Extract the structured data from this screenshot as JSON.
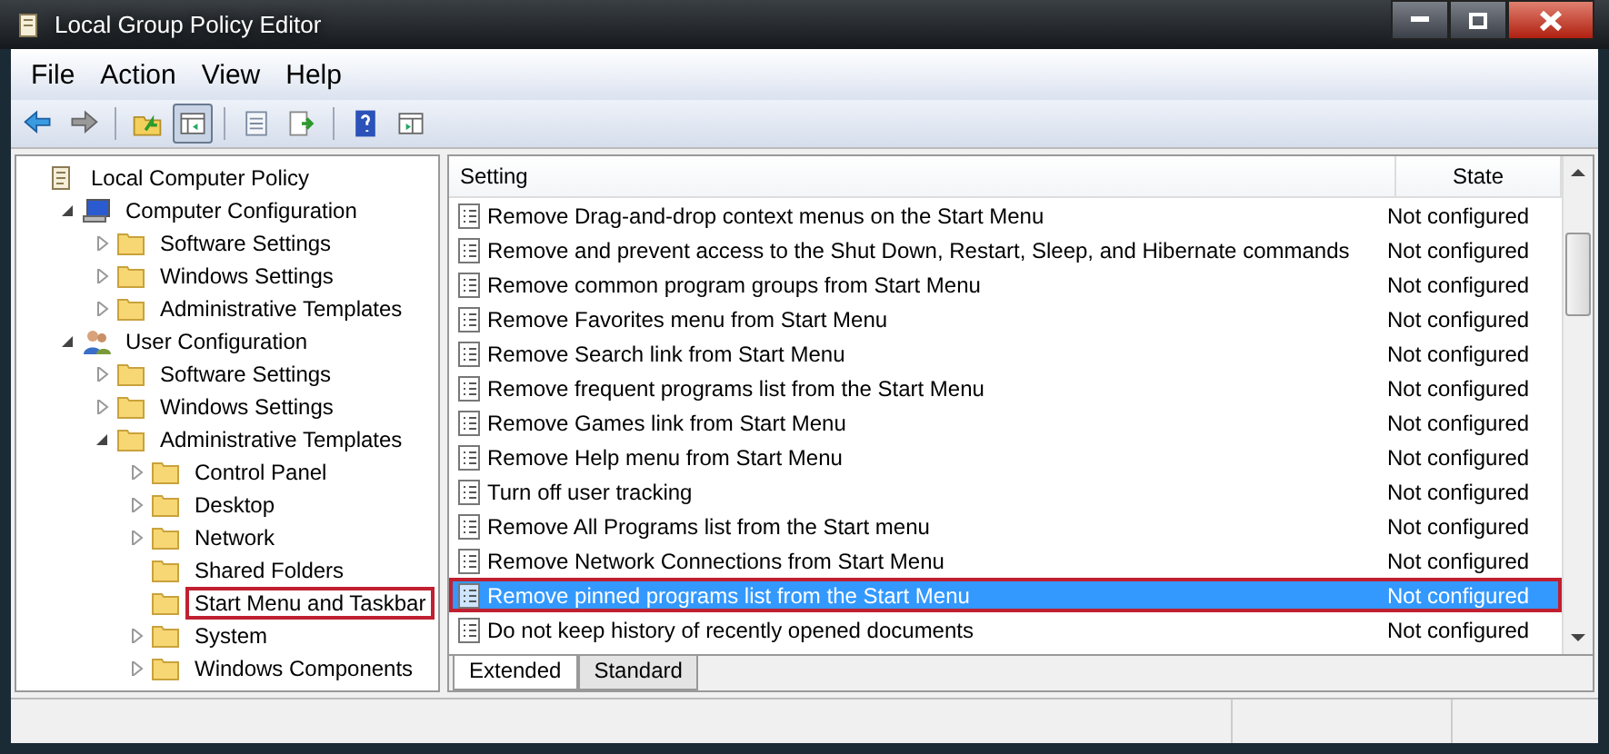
{
  "window": {
    "title": "Local Group Policy Editor"
  },
  "menu": [
    {
      "label": "File"
    },
    {
      "label": "Action"
    },
    {
      "label": "View"
    },
    {
      "label": "Help"
    }
  ],
  "toolbar": [
    {
      "kind": "back",
      "selected": false
    },
    {
      "kind": "forward",
      "selected": false
    },
    {
      "kind": "sep"
    },
    {
      "kind": "up",
      "selected": false
    },
    {
      "kind": "tree",
      "selected": true
    },
    {
      "kind": "sep"
    },
    {
      "kind": "properties",
      "selected": false
    },
    {
      "kind": "export",
      "selected": false
    },
    {
      "kind": "sep"
    },
    {
      "kind": "help",
      "selected": false
    },
    {
      "kind": "view",
      "selected": false
    }
  ],
  "tree": [
    {
      "label": "Local Computer Policy",
      "kind": "policy",
      "highlighted": false,
      "children": [
        {
          "label": "Computer Configuration",
          "kind": "computer",
          "expanded": true,
          "highlighted": false,
          "children": [
            {
              "label": "Software Settings",
              "kind": "folder",
              "expanded": false,
              "highlighted": false
            },
            {
              "label": "Windows Settings",
              "kind": "folder",
              "expanded": false,
              "highlighted": false
            },
            {
              "label": "Administrative Templates",
              "kind": "folder",
              "expanded": false,
              "highlighted": false
            }
          ]
        },
        {
          "label": "User Configuration",
          "kind": "user",
          "expanded": true,
          "highlighted": false,
          "children": [
            {
              "label": "Software Settings",
              "kind": "folder",
              "expanded": false,
              "highlighted": false
            },
            {
              "label": "Windows Settings",
              "kind": "folder",
              "expanded": false,
              "highlighted": false
            },
            {
              "label": "Administrative Templates",
              "kind": "folder",
              "expanded": true,
              "highlighted": false,
              "children": [
                {
                  "label": "Control Panel",
                  "kind": "folder",
                  "expanded": false,
                  "highlighted": false
                },
                {
                  "label": "Desktop",
                  "kind": "folder",
                  "expanded": false,
                  "highlighted": false
                },
                {
                  "label": "Network",
                  "kind": "folder",
                  "expanded": false,
                  "highlighted": false
                },
                {
                  "label": "Shared Folders",
                  "kind": "leaf",
                  "highlighted": false
                },
                {
                  "label": "Start Menu and Taskbar",
                  "kind": "leaf",
                  "highlighted": true
                },
                {
                  "label": "System",
                  "kind": "folder",
                  "expanded": false,
                  "highlighted": false
                },
                {
                  "label": "Windows Components",
                  "kind": "folder",
                  "expanded": false,
                  "highlighted": false
                }
              ]
            }
          ]
        }
      ]
    }
  ],
  "table": {
    "columns": [
      "Setting",
      "State"
    ],
    "rows": [
      {
        "setting": "Remove Drag-and-drop context menus on the Start Menu",
        "state": "Not configured",
        "selected": false,
        "highlighted": false
      },
      {
        "setting": "Remove and prevent access to the Shut Down, Restart, Sleep, and Hibernate commands",
        "state": "Not configured",
        "selected": false,
        "highlighted": false
      },
      {
        "setting": "Remove common program groups from Start Menu",
        "state": "Not configured",
        "selected": false,
        "highlighted": false
      },
      {
        "setting": "Remove Favorites menu from Start Menu",
        "state": "Not configured",
        "selected": false,
        "highlighted": false
      },
      {
        "setting": "Remove Search link from Start Menu",
        "state": "Not configured",
        "selected": false,
        "highlighted": false
      },
      {
        "setting": "Remove frequent programs list from the Start Menu",
        "state": "Not configured",
        "selected": false,
        "highlighted": false
      },
      {
        "setting": "Remove Games link from Start Menu",
        "state": "Not configured",
        "selected": false,
        "highlighted": false
      },
      {
        "setting": "Remove Help menu from Start Menu",
        "state": "Not configured",
        "selected": false,
        "highlighted": false
      },
      {
        "setting": "Turn off user tracking",
        "state": "Not configured",
        "selected": false,
        "highlighted": false
      },
      {
        "setting": "Remove All Programs list from the Start menu",
        "state": "Not configured",
        "selected": false,
        "highlighted": false
      },
      {
        "setting": "Remove Network Connections from Start Menu",
        "state": "Not configured",
        "selected": false,
        "highlighted": false
      },
      {
        "setting": "Remove pinned programs list from the Start Menu",
        "state": "Not configured",
        "selected": true,
        "highlighted": true
      },
      {
        "setting": "Do not keep history of recently opened documents",
        "state": "Not configured",
        "selected": false,
        "highlighted": false
      }
    ]
  },
  "view_tabs": [
    {
      "label": "Extended",
      "selected": true
    },
    {
      "label": "Standard",
      "selected": false
    }
  ]
}
